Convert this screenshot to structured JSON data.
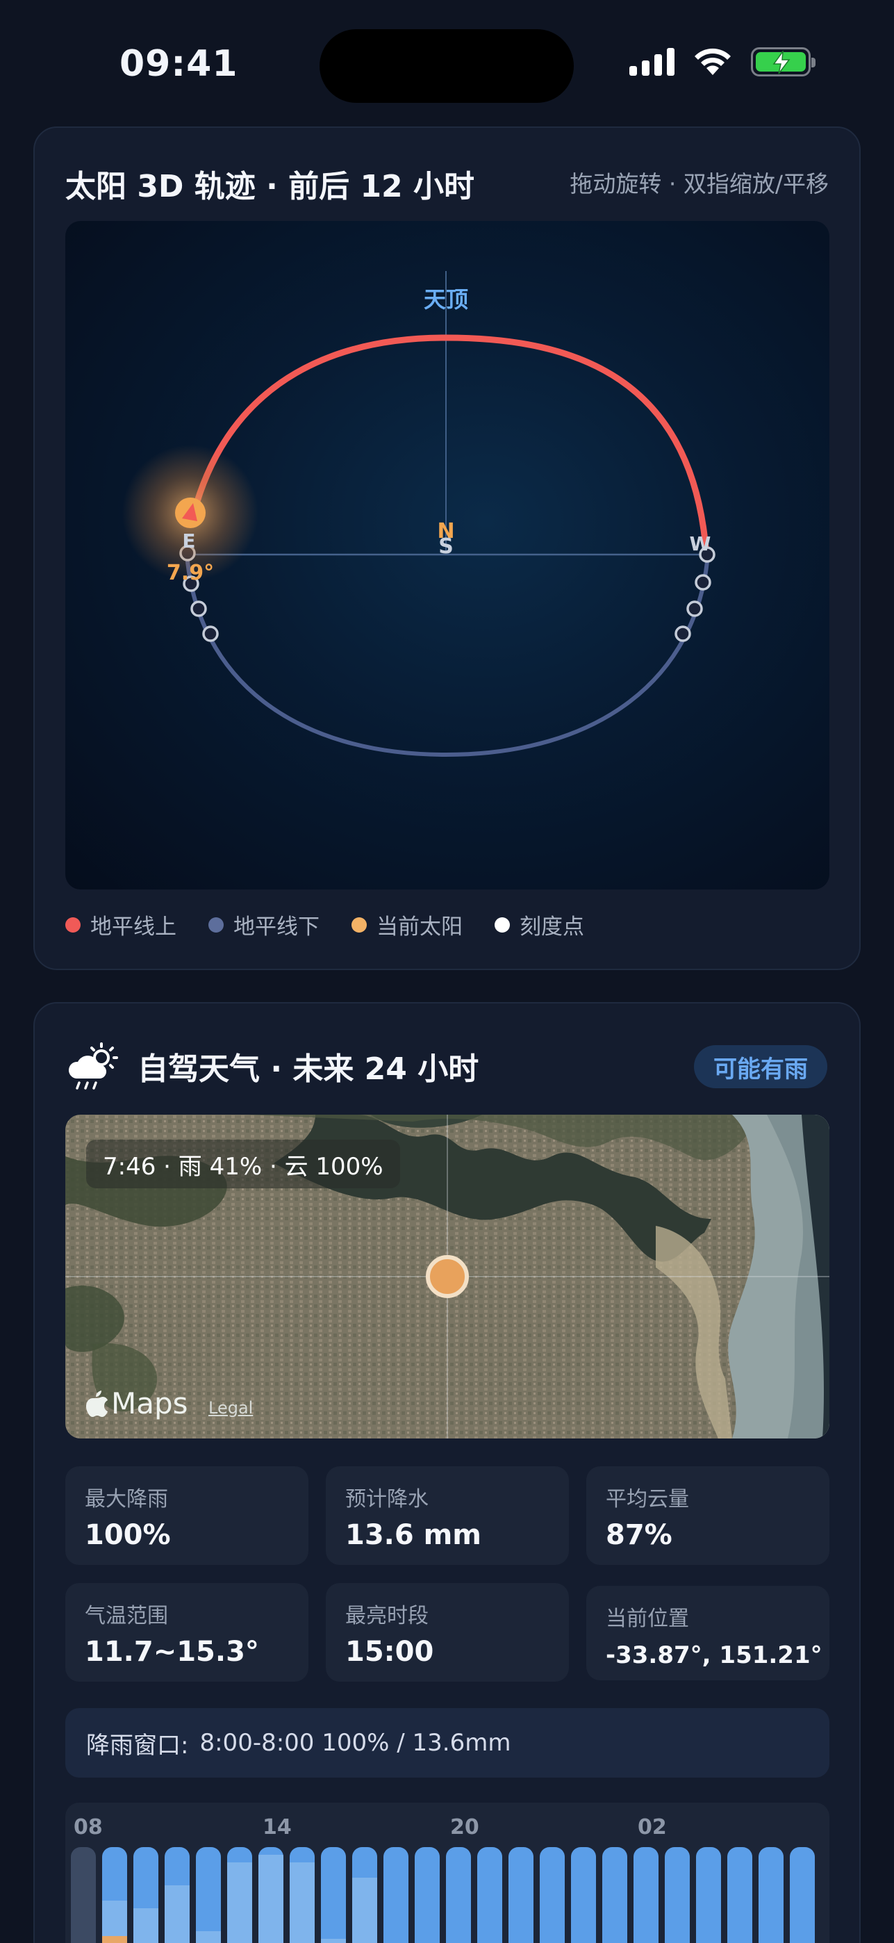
{
  "status_bar": {
    "time": "09:41"
  },
  "sun_card": {
    "title": "太阳 3D 轨迹 · 前后 12 小时",
    "hint": "拖动旋转 · 双指缩放/平移",
    "zenith_label": "天顶",
    "compass": {
      "north": "N",
      "south": "S",
      "east": "E",
      "west": "W"
    },
    "sun_altitude": "7.9°",
    "legend": [
      {
        "label": "地平线上",
        "color": "#f05a57"
      },
      {
        "label": "地平线下",
        "color": "#5d6e9c"
      },
      {
        "label": "当前太阳",
        "color": "#f3b266"
      },
      {
        "label": "刻度点",
        "color": "#ffffff"
      }
    ],
    "colors": {
      "above_horizon": "#f25a55",
      "below_horizon": "#4c5e8e",
      "sun": "#f3a64f"
    }
  },
  "weather_card": {
    "title": "自驾天气 · 未来 24 小时",
    "badge": "可能有雨",
    "icon": "cloud-sun-rain-icon",
    "map": {
      "overlay_label": "7:46 · 雨 41% · 云 100%",
      "maps_label": "Maps",
      "legal_label": "Legal"
    },
    "stats": [
      {
        "label": "最大降雨",
        "value": "100%"
      },
      {
        "label": "预计降水",
        "value": "13.6 mm"
      },
      {
        "label": "平均云量",
        "value": "87%"
      },
      {
        "label": "气温范围",
        "value": "11.7~15.3°"
      },
      {
        "label": "最亮时段",
        "value": "15:00"
      },
      {
        "label": "当前位置",
        "value": "-33.87°, 151.21°"
      }
    ],
    "rain_window": {
      "label": "降雨窗口:",
      "value": "8:00-8:00 100% / 13.6mm"
    },
    "hour_labels": [
      "08",
      "14",
      "20",
      "02"
    ],
    "hourly": [
      {
        "cloud": 0.25,
        "rain": 0.12
      },
      {
        "cloud": 0.65,
        "rain": 0.42
      },
      {
        "cloud": 0.6,
        "rain": 0.28
      },
      {
        "cloud": 0.75,
        "rain": 0.15
      },
      {
        "cloud": 0.45,
        "rain": 0.08
      },
      {
        "cloud": 0.9,
        "rain": 0.05
      },
      {
        "cloud": 0.95,
        "rain": 0.05
      },
      {
        "cloud": 0.9,
        "rain": 0.04
      },
      {
        "cloud": 0.4,
        "rain": 0.12
      },
      {
        "cloud": 0.8,
        "rain": 0.06
      },
      {
        "cloud": 0.0,
        "rain": 0.0
      },
      {
        "cloud": 0.0,
        "rain": 0.0
      },
      {
        "cloud": 0.0,
        "rain": 0.0
      },
      {
        "cloud": 0.0,
        "rain": 0.0
      },
      {
        "cloud": 0.0,
        "rain": 0.0
      },
      {
        "cloud": 0.0,
        "rain": 0.0
      },
      {
        "cloud": 0.0,
        "rain": 0.0
      },
      {
        "cloud": 0.0,
        "rain": 0.0
      },
      {
        "cloud": 0.0,
        "rain": 0.0
      },
      {
        "cloud": 0.0,
        "rain": 0.0
      },
      {
        "cloud": 0.0,
        "rain": 0.0
      },
      {
        "cloud": 0.0,
        "rain": 0.0
      },
      {
        "cloud": 0.0,
        "rain": 0.0
      },
      {
        "cloud": 0.0,
        "rain": 0.0
      }
    ]
  }
}
